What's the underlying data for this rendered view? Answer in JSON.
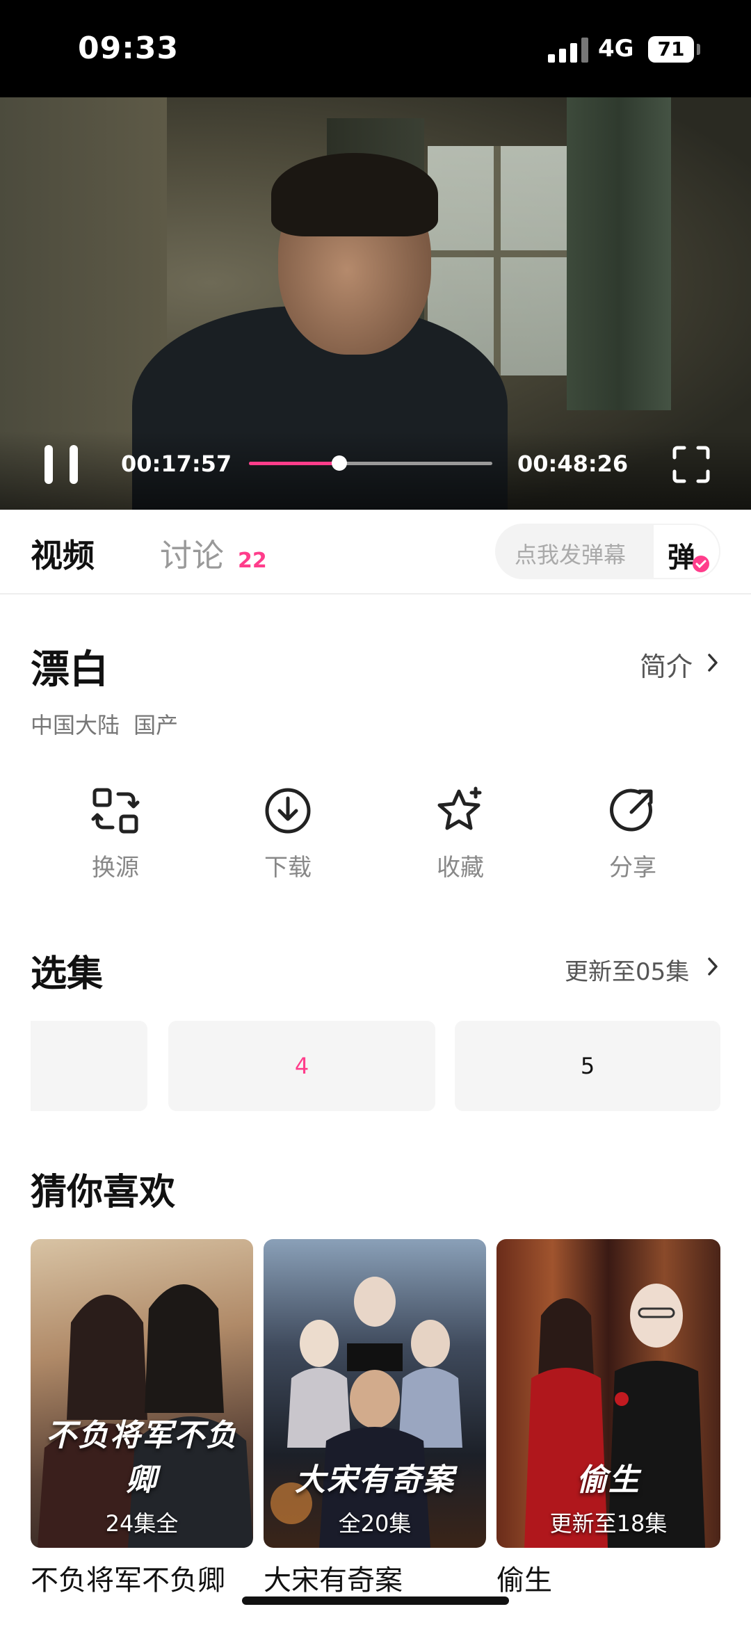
{
  "status_bar": {
    "time": "09:33",
    "network": "4G",
    "battery": "71"
  },
  "player": {
    "current_time": "00:17:57",
    "total_time": "00:48:26",
    "progress": 0.371
  },
  "tabs": {
    "video": "视频",
    "discussion": "讨论",
    "discussion_count": "22"
  },
  "danmaku": {
    "placeholder": "点我发弹幕",
    "button": "弹"
  },
  "show": {
    "title": "漂白",
    "intro_link": "简介",
    "meta": "中国大陆  国产"
  },
  "actions": [
    {
      "label": "换源",
      "icon": "switch-source-icon"
    },
    {
      "label": "下载",
      "icon": "download-icon"
    },
    {
      "label": "收藏",
      "icon": "star-icon"
    },
    {
      "label": "分享",
      "icon": "share-icon"
    }
  ],
  "episodes": {
    "heading": "选集",
    "update": "更新至05集",
    "items": [
      {
        "label": ""
      },
      {
        "label": "4"
      },
      {
        "label": "5"
      }
    ]
  },
  "recommend": {
    "heading": "猜你喜欢",
    "items": [
      {
        "name": "不负将军不负卿",
        "badge": "24集全",
        "title_art": "不负将军不负卿"
      },
      {
        "name": "大宋有奇案",
        "badge": "全20集",
        "title_art": "大宋有奇案"
      },
      {
        "name": "偷生",
        "badge": "更新至18集",
        "title_art": "偷生"
      }
    ]
  },
  "colors": {
    "accent": "#ff3d8b",
    "black": "#000000",
    "muted": "#999999"
  }
}
